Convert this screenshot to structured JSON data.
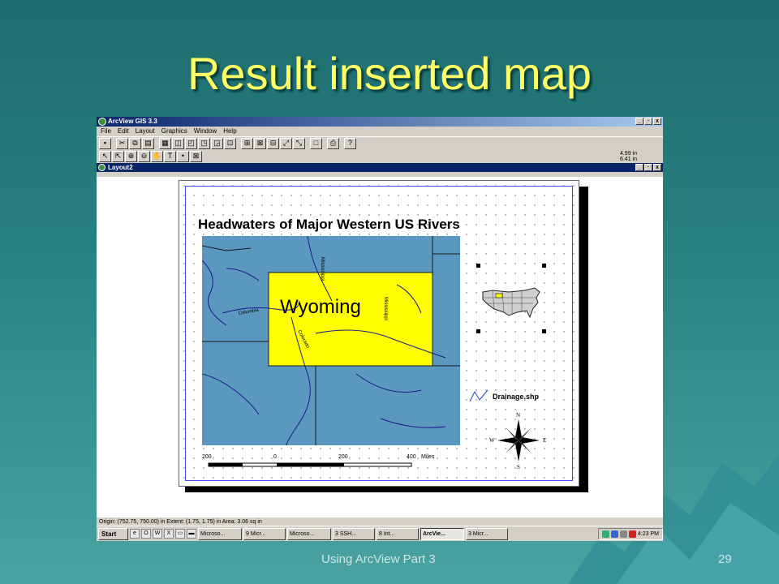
{
  "slide": {
    "title": "Result inserted map",
    "footer": "Using ArcView Part 3",
    "page_number": "29"
  },
  "app": {
    "title": "ArcView GIS 3.3",
    "window_controls": [
      "_",
      "·",
      "x"
    ],
    "menu": [
      "File",
      "Edit",
      "Layout",
      "Graphics",
      "Window",
      "Help"
    ],
    "coords": {
      "x": "4.99 in",
      "y": "6.41 in"
    }
  },
  "document": {
    "title": "Layout2"
  },
  "map_layout": {
    "title": "Headwaters of Major Western US Rivers",
    "state_label": "Wyoming",
    "rivers": [
      "Mississippi",
      "Columbia",
      "Colorado",
      "Mississippi"
    ],
    "scale_labels": [
      "200",
      "0",
      "200",
      "400",
      "Miles"
    ],
    "legend_label": "Drainage.shp",
    "compass": {
      "n": "N",
      "s": "S",
      "e": "E",
      "w": "W"
    }
  },
  "status": {
    "text": "Origin: (752.75, 750.00) in  Extent: (1.75, 1.75) in  Area: 3.06 sq in"
  },
  "taskbar": {
    "start": "Start",
    "tasks": [
      "Microso...",
      "9 Micr...",
      "Microso...",
      "3 SSH...",
      "8 Int...",
      "ArcVie...",
      "3 Micr..."
    ],
    "clock": "4:23 PM"
  },
  "colors": {
    "slide_title": "#ffff66",
    "water": "#5b98bf",
    "wyoming": "#ffff00",
    "title_bar": "#0a246a"
  }
}
